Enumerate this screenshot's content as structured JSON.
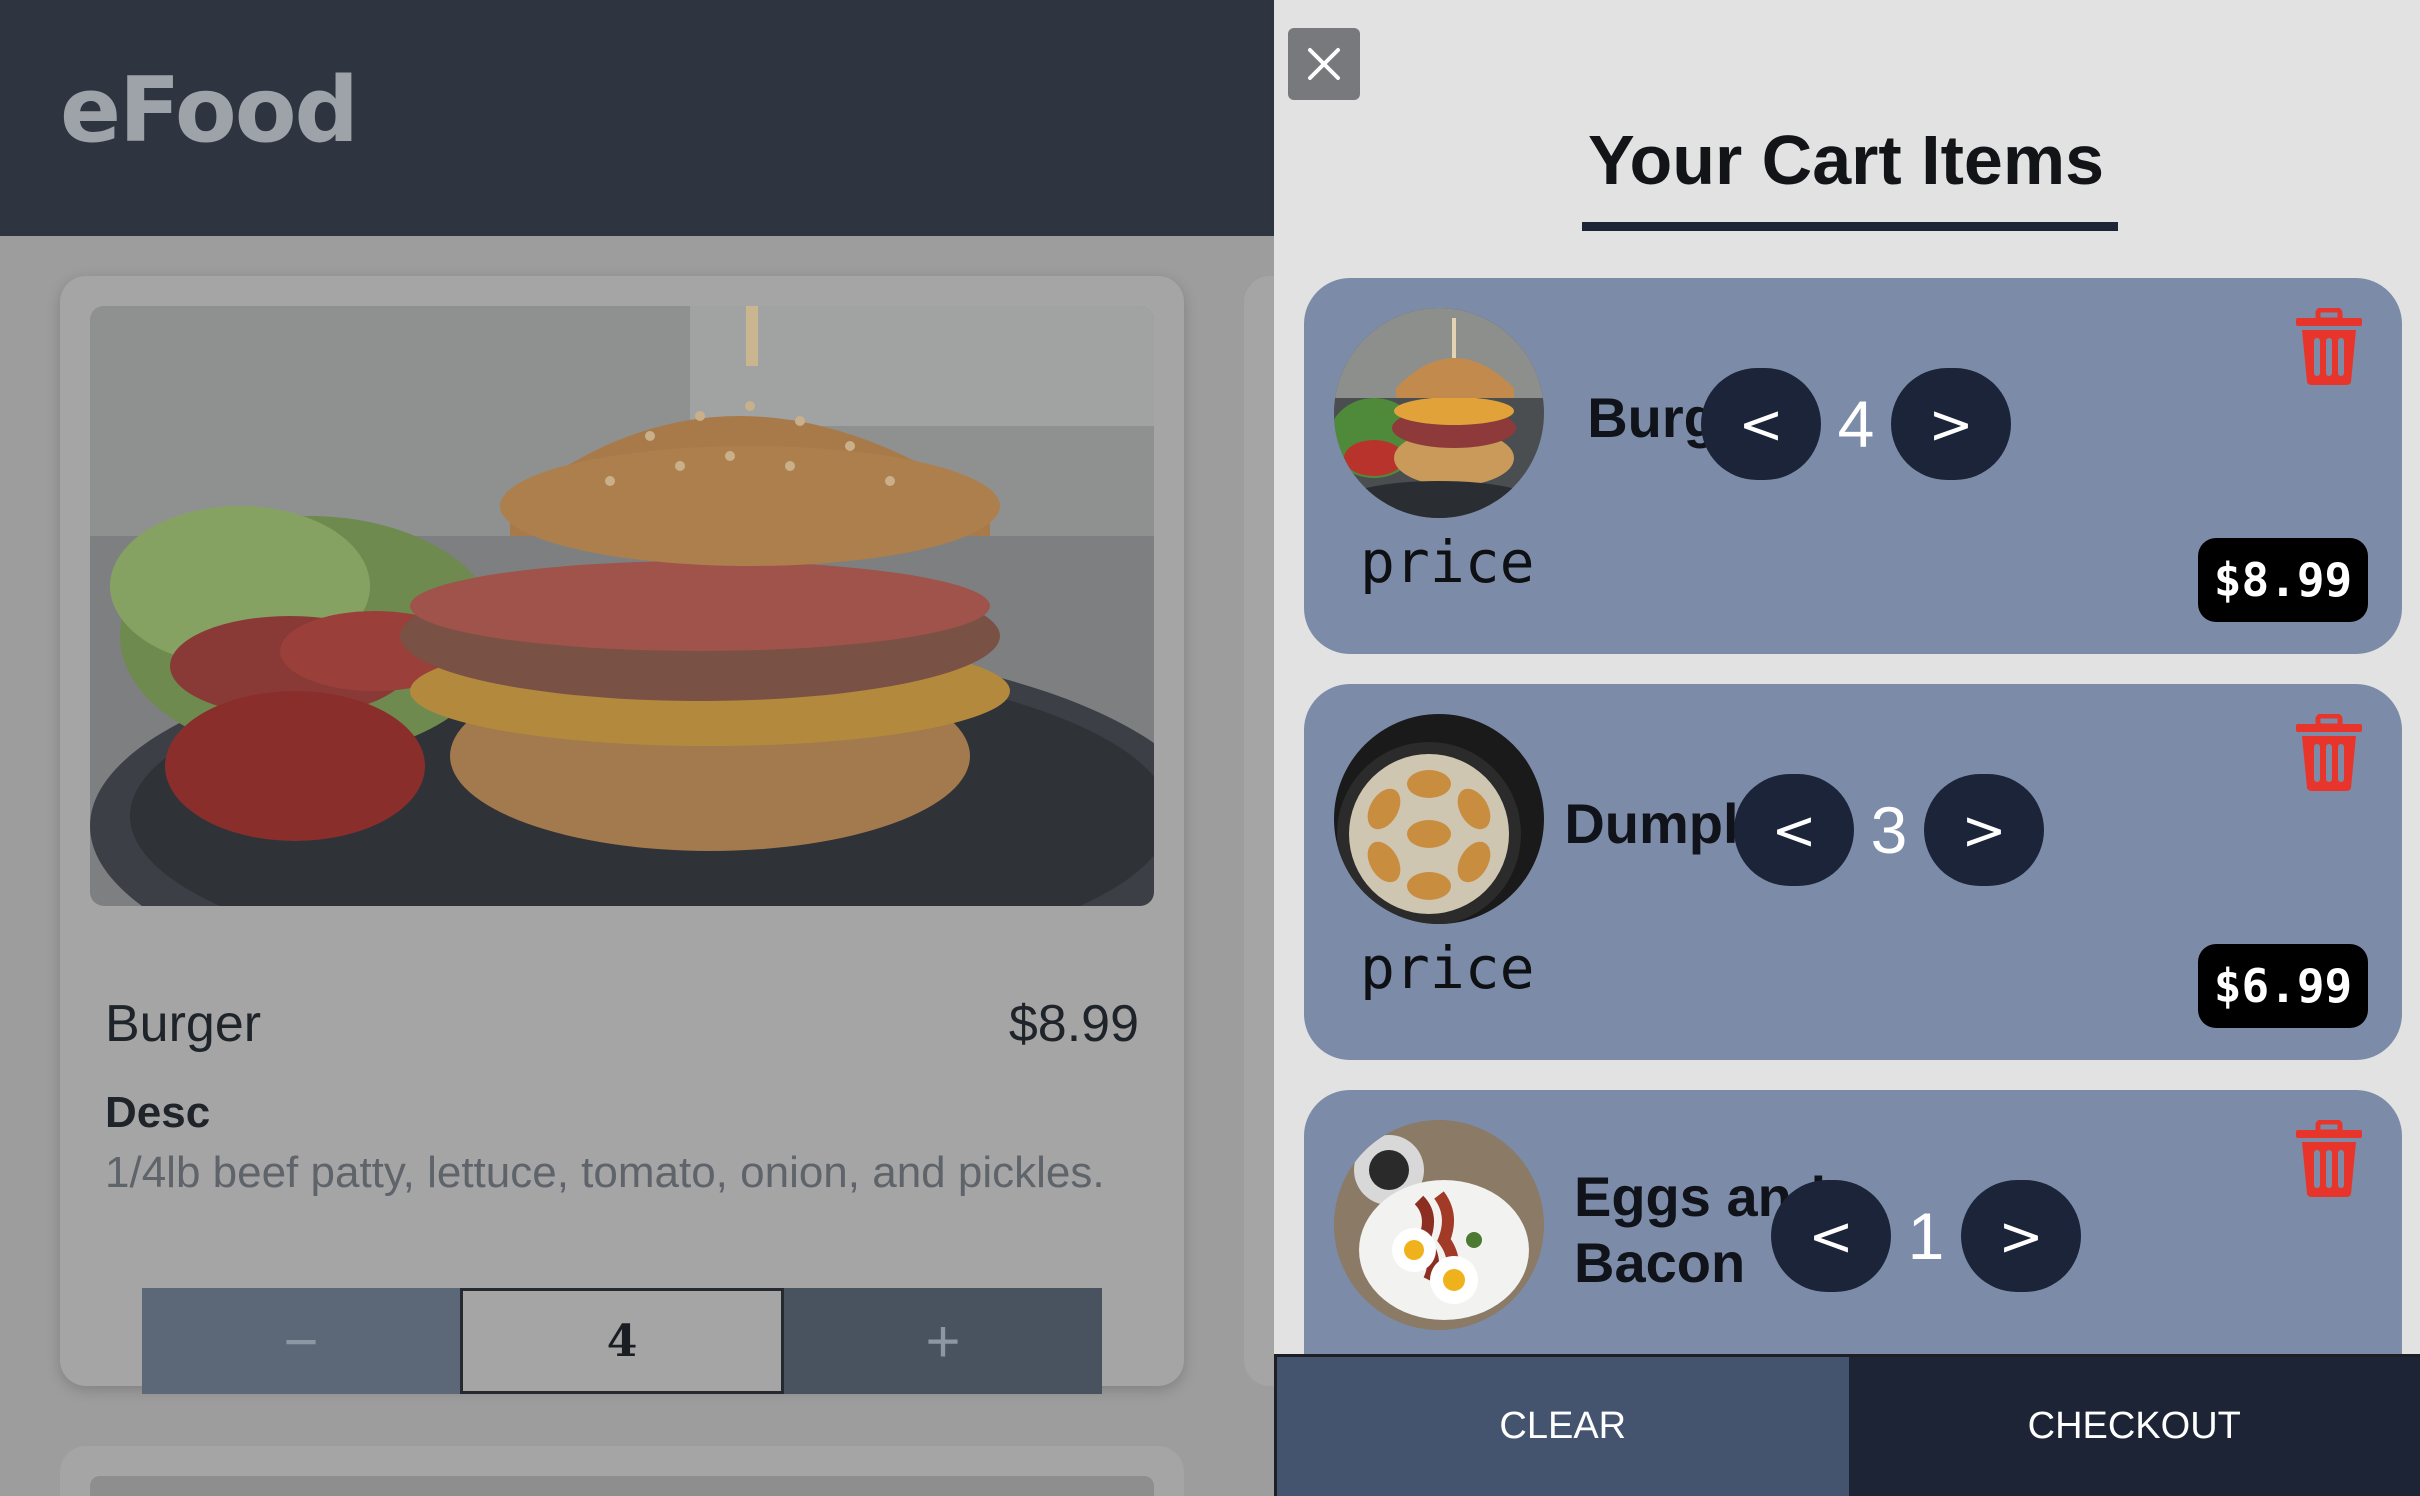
{
  "header": {
    "brand": "eFood"
  },
  "product_card": {
    "name": "Burger",
    "price": "$8.99",
    "desc_label": "Desc",
    "description": "1/4lb beef patty, lettuce, tomato, onion, and pickles.",
    "quantity": "4",
    "minus_symbol": "−",
    "plus_symbol": "+",
    "image_icon": "burger-photo"
  },
  "cart": {
    "close_icon": "close-icon",
    "title": "Your Cart Items",
    "price_label": "price",
    "decrement_label": "<",
    "increment_label": ">",
    "items": [
      {
        "name": "Burger",
        "quantity": "4",
        "price": "$8.99",
        "thumb": "burger-photo"
      },
      {
        "name": "Dumplings",
        "quantity": "3",
        "price": "$6.99",
        "thumb": "dumplings-photo"
      },
      {
        "name": "Eggs and Bacon",
        "quantity": "1",
        "price": "",
        "thumb": "eggs-bacon-photo"
      }
    ],
    "clear_label": "CLEAR",
    "checkout_label": "CHECKOUT"
  },
  "colors": {
    "header_bg": "#2e3540",
    "drawer_bg": "#e2e2e2",
    "item_bg": "#7c8ca8",
    "stepper_bg": "#1b2438",
    "trash_red": "#e8352c",
    "clear_bg": "#44546f",
    "checkout_bg": "#1d2436"
  }
}
